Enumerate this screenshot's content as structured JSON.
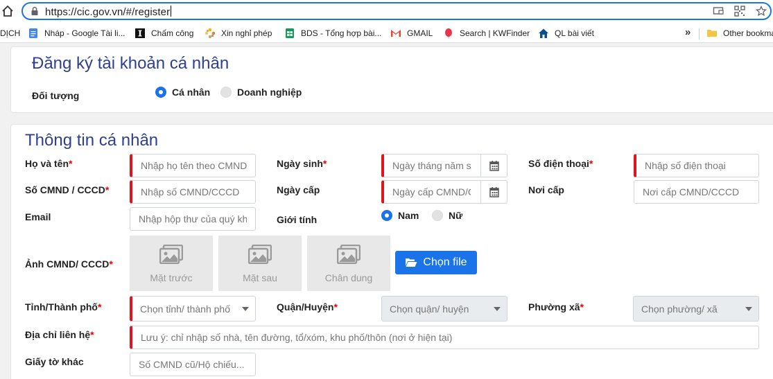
{
  "browser": {
    "url": "https://cic.gov.vn/#/register",
    "bookmarks": [
      {
        "label": "DỊCH",
        "icon": "none"
      },
      {
        "label": "Nháp - Google Tài li...",
        "icon": "google-docs-icon"
      },
      {
        "label": "Chấm công",
        "icon": "instapaper-icon"
      },
      {
        "label": "Xin nghỉ phép",
        "icon": "pinwheel-icon"
      },
      {
        "label": "BDS - Tổng hợp bài...",
        "icon": "google-sheets-icon"
      },
      {
        "label": "GMAIL",
        "icon": "gmail-icon"
      },
      {
        "label": "Search | KWFinder",
        "icon": "kwfinder-icon"
      },
      {
        "label": "QL bài viết",
        "icon": "house-icon"
      },
      {
        "label": "Other bookmarks",
        "icon": "folder-icon"
      }
    ],
    "more": "»"
  },
  "account": {
    "title": "Đăng ký tài khoản cá nhân",
    "subject_label": "Đối tượng",
    "options": [
      {
        "label": "Cá nhân",
        "selected": true
      },
      {
        "label": "Doanh nghiệp",
        "selected": false
      }
    ]
  },
  "personal": {
    "title": "Thông tin cá nhân",
    "required_mark": "*",
    "fields": {
      "fullname": {
        "label": "Họ và tên",
        "placeholder": "Nhập họ tên theo CMND"
      },
      "dob": {
        "label": "Ngày sinh",
        "placeholder": "Ngày tháng năm sinh"
      },
      "phone": {
        "label": "Số điện thoại",
        "placeholder": "Nhập số điện thoại"
      },
      "idnum": {
        "label": "Số CMND / CCCD",
        "placeholder": "Nhập số CMND/CCCD"
      },
      "issue_date": {
        "label": "Ngày cấp",
        "placeholder": "Ngày cấp CMND/CCCD"
      },
      "issue_place": {
        "label": "Nơi cấp",
        "placeholder": "Nơi cấp CMND/CCCD"
      },
      "email": {
        "label": "Email",
        "placeholder": "Nhập hộp thư của quý khách"
      },
      "gender": {
        "label": "Giới tính",
        "options": [
          {
            "label": "Nam",
            "selected": true
          },
          {
            "label": "Nữ",
            "selected": false
          }
        ]
      },
      "id_photo": {
        "label": "Ảnh CMND/ CCCD",
        "slots": [
          "Mặt trước",
          "Mặt sau",
          "Chân dung"
        ],
        "button": "Chọn file"
      },
      "province": {
        "label": "Tỉnh/Thành phố",
        "value": "Chọn tỉnh/ thành phố"
      },
      "district": {
        "label": "Quận/Huyện",
        "value": "Chọn quận/ huyện"
      },
      "ward": {
        "label": "Phường xã",
        "value": "Chọn phường/ xã"
      },
      "address": {
        "label": "Địa chỉ liên hệ",
        "placeholder": "Lưu ý: chỉ nhập số nhà, tên đường, tổ/xóm, khu phố/thôn (nơi ở hiện tại)"
      },
      "other_docs": {
        "label": "Giấy tờ khác",
        "placeholder": "Số CMND cũ/Hộ chiếu..."
      }
    }
  },
  "colors": {
    "accent": "#1a73e8",
    "title": "#2e3f8f",
    "required": "#e0141e"
  }
}
